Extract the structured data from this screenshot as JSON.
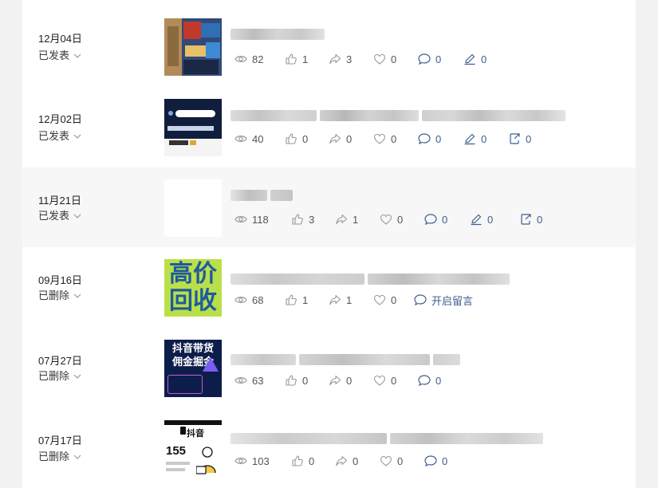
{
  "posts": [
    {
      "date": "12月04日",
      "status": "已发表",
      "views": "82",
      "likes": "1",
      "shares": "3",
      "favs": "0",
      "comments": "0",
      "edits": "0",
      "extra": null
    },
    {
      "date": "12月02日",
      "status": "已发表",
      "views": "40",
      "likes": "0",
      "shares": "0",
      "favs": "0",
      "comments": "0",
      "edits": "0",
      "extra": "0"
    },
    {
      "date": "11月21日",
      "status": "已发表",
      "views": "118",
      "likes": "3",
      "shares": "1",
      "favs": "0",
      "comments": "0",
      "edits": "0",
      "extra": "0"
    },
    {
      "date": "09月16日",
      "status": "已删除",
      "views": "68",
      "likes": "1",
      "shares": "1",
      "favs": "0",
      "comments": "开启留言",
      "edits": null,
      "extra": null
    },
    {
      "date": "07月27日",
      "status": "已删除",
      "views": "63",
      "likes": "0",
      "shares": "0",
      "favs": "0",
      "comments": "0",
      "edits": null,
      "extra": null
    },
    {
      "date": "07月17日",
      "status": "已删除",
      "views": "103",
      "likes": "0",
      "shares": "0",
      "favs": "0",
      "comments": "0",
      "edits": null,
      "extra": null
    }
  ],
  "thumbs": {
    "t4_line1": "高价",
    "t4_line2": "回收",
    "t5_line1": "抖音带货",
    "t5_line2": "佣金掘金",
    "t6_brand": "抖音",
    "t6_number": "155"
  },
  "colors": {
    "accent": "#3f5d8c",
    "muted": "#8a8a8a",
    "highlight_row": "#f7f7f8"
  }
}
